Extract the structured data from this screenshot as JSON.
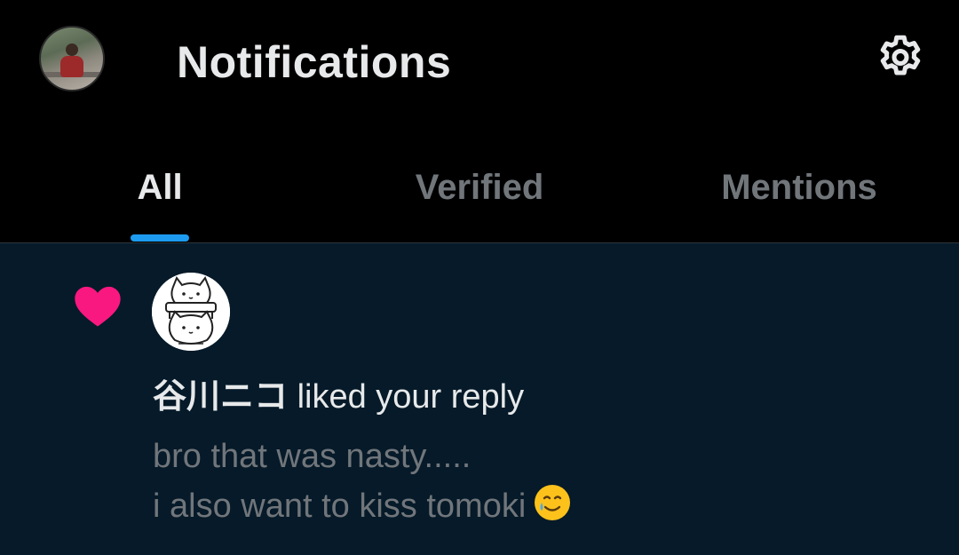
{
  "header": {
    "title": "Notifications",
    "avatar_icon": "user-avatar",
    "settings_icon": "gear-icon"
  },
  "tabs": [
    {
      "label": "All",
      "active": true
    },
    {
      "label": "Verified",
      "active": false
    },
    {
      "label": "Mentions",
      "active": false
    }
  ],
  "colors": {
    "accent": "#1d9bf0",
    "like": "#f91880",
    "background": "#000000",
    "unread_background": "#061a29",
    "primary_text": "#e7e9ea",
    "secondary_text": "#71767b"
  },
  "notification": {
    "type_icon": "heart-icon",
    "actor_avatar_icon": "cartoon-cat-avatar",
    "actor_name": "谷川ニコ",
    "action": " liked your reply",
    "snippet": {
      "line1": "bro that was nasty.....",
      "line2": "i also want to kiss tomoki",
      "emoji": "smiling-face-with-tear-emoji"
    }
  }
}
